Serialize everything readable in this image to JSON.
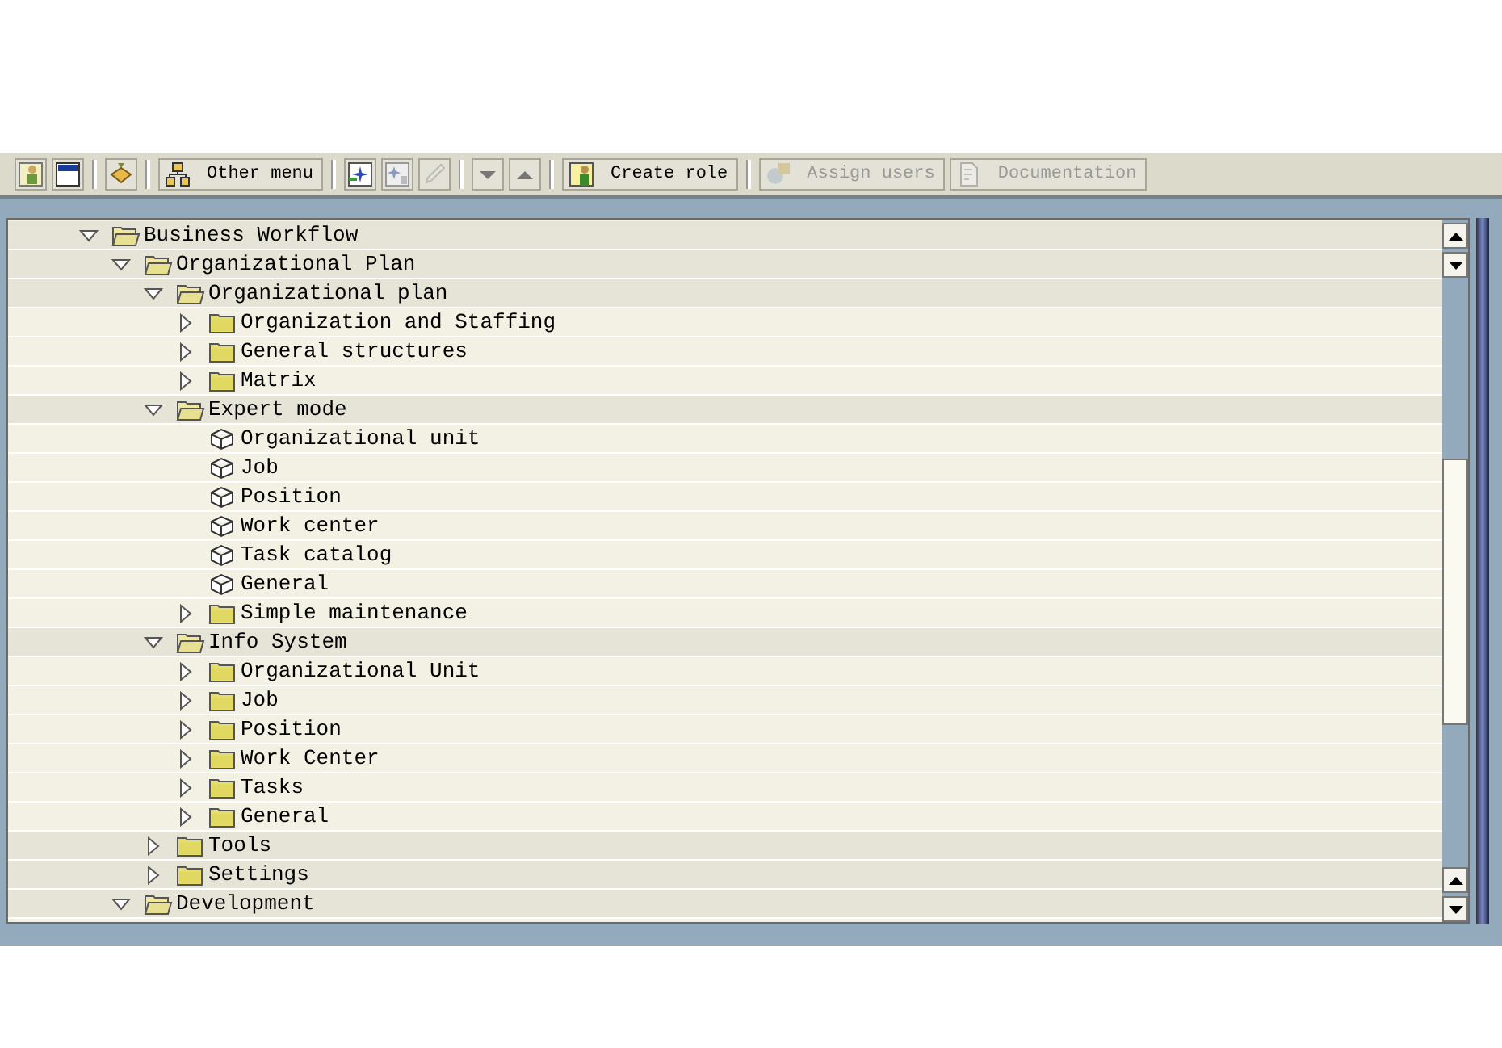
{
  "toolbar": [
    {
      "kind": "icon",
      "disabled": false
    },
    {
      "kind": "icon",
      "disabled": false
    },
    {
      "kind": "separator"
    },
    {
      "kind": "icon",
      "disabled": false
    },
    {
      "kind": "separator"
    },
    {
      "kind": "text",
      "label": "Other menu",
      "disabled": false
    },
    {
      "kind": "separator"
    },
    {
      "kind": "icon",
      "disabled": false
    },
    {
      "kind": "icon",
      "disabled": false
    },
    {
      "kind": "icon",
      "disabled": true
    },
    {
      "kind": "separator"
    },
    {
      "kind": "icon",
      "disabled": false
    },
    {
      "kind": "icon",
      "disabled": false
    },
    {
      "kind": "separator"
    },
    {
      "kind": "text",
      "label": "Create role",
      "disabled": false
    },
    {
      "kind": "separator"
    },
    {
      "kind": "text",
      "label": "Assign users",
      "disabled": true
    },
    {
      "kind": "text",
      "label": "Documentation",
      "disabled": true
    }
  ],
  "tree": [
    {
      "kind": "folder",
      "label": "Business Workflow",
      "expanded": true,
      "children": [
        {
          "kind": "folder",
          "label": "Organizational Plan",
          "expanded": true,
          "children": [
            {
              "kind": "folder",
              "label": "Organizational plan",
              "expanded": true,
              "children": [
                {
                  "kind": "folder",
                  "label": "Organization and Staffing",
                  "expanded": false
                },
                {
                  "kind": "folder",
                  "label": "General structures",
                  "expanded": false
                },
                {
                  "kind": "folder",
                  "label": "Matrix",
                  "expanded": false
                }
              ]
            },
            {
              "kind": "folder",
              "label": "Expert mode",
              "expanded": true,
              "children": [
                {
                  "kind": "item",
                  "label": "Organizational unit"
                },
                {
                  "kind": "item",
                  "label": "Job"
                },
                {
                  "kind": "item",
                  "label": "Position"
                },
                {
                  "kind": "item",
                  "label": "Work center"
                },
                {
                  "kind": "item",
                  "label": "Task catalog"
                },
                {
                  "kind": "item",
                  "label": "General"
                },
                {
                  "kind": "folder",
                  "label": "Simple maintenance",
                  "expanded": false
                }
              ]
            },
            {
              "kind": "folder",
              "label": "Info System",
              "expanded": true,
              "children": [
                {
                  "kind": "folder",
                  "label": "Organizational Unit",
                  "expanded": false
                },
                {
                  "kind": "folder",
                  "label": "Job",
                  "expanded": false
                },
                {
                  "kind": "folder",
                  "label": "Position",
                  "expanded": false
                },
                {
                  "kind": "folder",
                  "label": "Work Center",
                  "expanded": false
                },
                {
                  "kind": "folder",
                  "label": "Tasks",
                  "expanded": false
                },
                {
                  "kind": "folder",
                  "label": "General",
                  "expanded": false
                }
              ]
            },
            {
              "kind": "folder",
              "label": "Tools",
              "expanded": false
            },
            {
              "kind": "folder",
              "label": "Settings",
              "expanded": false
            }
          ]
        },
        {
          "kind": "folder",
          "label": "Development",
          "expanded": true
        }
      ]
    }
  ]
}
